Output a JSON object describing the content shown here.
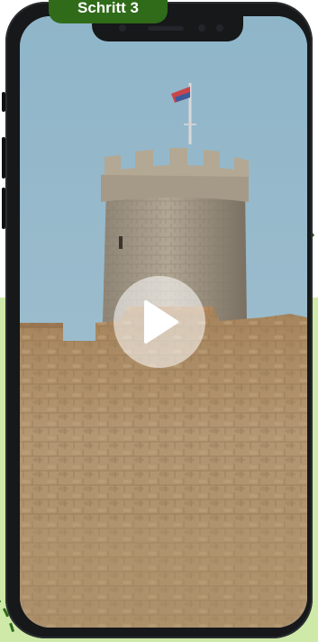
{
  "step_badge": {
    "label": "Schritt 3"
  },
  "video": {
    "play_icon": "play-icon",
    "image": "castle-tower-photo"
  },
  "colors": {
    "badge": "#2f6b19",
    "accent_light": "#cfe9a8",
    "dash": "#2f6b19"
  }
}
